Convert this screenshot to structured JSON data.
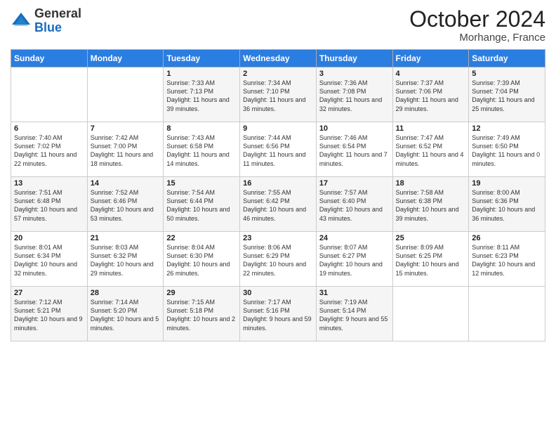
{
  "header": {
    "logo_general": "General",
    "logo_blue": "Blue",
    "month_title": "October 2024",
    "location": "Morhange, France"
  },
  "weekdays": [
    "Sunday",
    "Monday",
    "Tuesday",
    "Wednesday",
    "Thursday",
    "Friday",
    "Saturday"
  ],
  "weeks": [
    [
      {
        "day": "",
        "info": ""
      },
      {
        "day": "",
        "info": ""
      },
      {
        "day": "1",
        "info": "Sunrise: 7:33 AM\nSunset: 7:13 PM\nDaylight: 11 hours and 39 minutes."
      },
      {
        "day": "2",
        "info": "Sunrise: 7:34 AM\nSunset: 7:10 PM\nDaylight: 11 hours and 36 minutes."
      },
      {
        "day": "3",
        "info": "Sunrise: 7:36 AM\nSunset: 7:08 PM\nDaylight: 11 hours and 32 minutes."
      },
      {
        "day": "4",
        "info": "Sunrise: 7:37 AM\nSunset: 7:06 PM\nDaylight: 11 hours and 29 minutes."
      },
      {
        "day": "5",
        "info": "Sunrise: 7:39 AM\nSunset: 7:04 PM\nDaylight: 11 hours and 25 minutes."
      }
    ],
    [
      {
        "day": "6",
        "info": "Sunrise: 7:40 AM\nSunset: 7:02 PM\nDaylight: 11 hours and 22 minutes."
      },
      {
        "day": "7",
        "info": "Sunrise: 7:42 AM\nSunset: 7:00 PM\nDaylight: 11 hours and 18 minutes."
      },
      {
        "day": "8",
        "info": "Sunrise: 7:43 AM\nSunset: 6:58 PM\nDaylight: 11 hours and 14 minutes."
      },
      {
        "day": "9",
        "info": "Sunrise: 7:44 AM\nSunset: 6:56 PM\nDaylight: 11 hours and 11 minutes."
      },
      {
        "day": "10",
        "info": "Sunrise: 7:46 AM\nSunset: 6:54 PM\nDaylight: 11 hours and 7 minutes."
      },
      {
        "day": "11",
        "info": "Sunrise: 7:47 AM\nSunset: 6:52 PM\nDaylight: 11 hours and 4 minutes."
      },
      {
        "day": "12",
        "info": "Sunrise: 7:49 AM\nSunset: 6:50 PM\nDaylight: 11 hours and 0 minutes."
      }
    ],
    [
      {
        "day": "13",
        "info": "Sunrise: 7:51 AM\nSunset: 6:48 PM\nDaylight: 10 hours and 57 minutes."
      },
      {
        "day": "14",
        "info": "Sunrise: 7:52 AM\nSunset: 6:46 PM\nDaylight: 10 hours and 53 minutes."
      },
      {
        "day": "15",
        "info": "Sunrise: 7:54 AM\nSunset: 6:44 PM\nDaylight: 10 hours and 50 minutes."
      },
      {
        "day": "16",
        "info": "Sunrise: 7:55 AM\nSunset: 6:42 PM\nDaylight: 10 hours and 46 minutes."
      },
      {
        "day": "17",
        "info": "Sunrise: 7:57 AM\nSunset: 6:40 PM\nDaylight: 10 hours and 43 minutes."
      },
      {
        "day": "18",
        "info": "Sunrise: 7:58 AM\nSunset: 6:38 PM\nDaylight: 10 hours and 39 minutes."
      },
      {
        "day": "19",
        "info": "Sunrise: 8:00 AM\nSunset: 6:36 PM\nDaylight: 10 hours and 36 minutes."
      }
    ],
    [
      {
        "day": "20",
        "info": "Sunrise: 8:01 AM\nSunset: 6:34 PM\nDaylight: 10 hours and 32 minutes."
      },
      {
        "day": "21",
        "info": "Sunrise: 8:03 AM\nSunset: 6:32 PM\nDaylight: 10 hours and 29 minutes."
      },
      {
        "day": "22",
        "info": "Sunrise: 8:04 AM\nSunset: 6:30 PM\nDaylight: 10 hours and 26 minutes."
      },
      {
        "day": "23",
        "info": "Sunrise: 8:06 AM\nSunset: 6:29 PM\nDaylight: 10 hours and 22 minutes."
      },
      {
        "day": "24",
        "info": "Sunrise: 8:07 AM\nSunset: 6:27 PM\nDaylight: 10 hours and 19 minutes."
      },
      {
        "day": "25",
        "info": "Sunrise: 8:09 AM\nSunset: 6:25 PM\nDaylight: 10 hours and 15 minutes."
      },
      {
        "day": "26",
        "info": "Sunrise: 8:11 AM\nSunset: 6:23 PM\nDaylight: 10 hours and 12 minutes."
      }
    ],
    [
      {
        "day": "27",
        "info": "Sunrise: 7:12 AM\nSunset: 5:21 PM\nDaylight: 10 hours and 9 minutes."
      },
      {
        "day": "28",
        "info": "Sunrise: 7:14 AM\nSunset: 5:20 PM\nDaylight: 10 hours and 5 minutes."
      },
      {
        "day": "29",
        "info": "Sunrise: 7:15 AM\nSunset: 5:18 PM\nDaylight: 10 hours and 2 minutes."
      },
      {
        "day": "30",
        "info": "Sunrise: 7:17 AM\nSunset: 5:16 PM\nDaylight: 9 hours and 59 minutes."
      },
      {
        "day": "31",
        "info": "Sunrise: 7:19 AM\nSunset: 5:14 PM\nDaylight: 9 hours and 55 minutes."
      },
      {
        "day": "",
        "info": ""
      },
      {
        "day": "",
        "info": ""
      }
    ]
  ]
}
